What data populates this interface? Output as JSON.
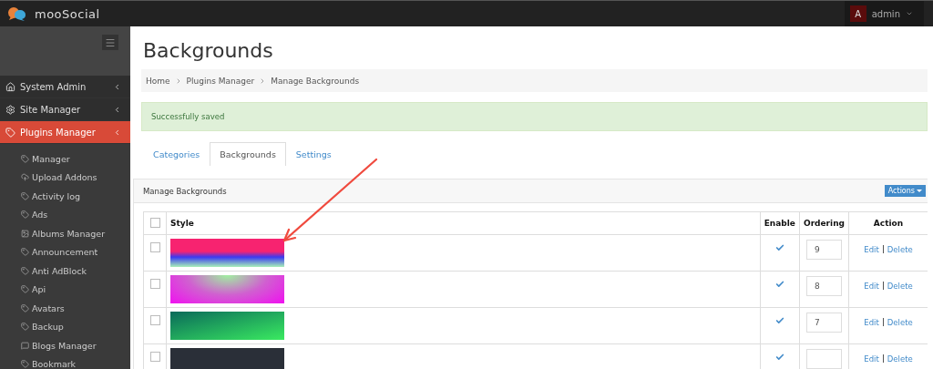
{
  "topbar": {
    "logo": "mooSocial",
    "user": {
      "initial": "A",
      "name": "admin"
    }
  },
  "sidebar": {
    "sections": [
      {
        "label": "System Admin",
        "selected": false
      },
      {
        "label": "Site Manager",
        "selected": false
      },
      {
        "label": "Plugins Manager",
        "selected": true
      }
    ],
    "items": [
      {
        "label": "Manager"
      },
      {
        "label": "Upload Addons"
      },
      {
        "label": "Activity log"
      },
      {
        "label": "Ads"
      },
      {
        "label": "Albums Manager"
      },
      {
        "label": "Announcement"
      },
      {
        "label": "Anti AdBlock"
      },
      {
        "label": "Api"
      },
      {
        "label": "Avatars"
      },
      {
        "label": "Backup"
      },
      {
        "label": "Blogs Manager"
      },
      {
        "label": "Bookmark"
      }
    ]
  },
  "page": {
    "title": "Backgrounds",
    "breadcrumb": [
      "Home",
      "Plugins Manager",
      "Manage Backgrounds"
    ],
    "alert": "Successfully saved",
    "tabs": [
      {
        "label": "Categories",
        "selected": false
      },
      {
        "label": "Backgrounds",
        "selected": true
      },
      {
        "label": "Settings",
        "selected": false
      }
    ],
    "panel": {
      "title": "Manage Backgrounds",
      "actions": "Actions",
      "table": {
        "select_all": {
          "checked": false
        },
        "columns": [
          "Style",
          "Enable",
          "Ordering",
          "Action"
        ],
        "rows": [
          {
            "checked": false,
            "kind": "vertical",
            "enabled": true,
            "ordering": "9",
            "edit": "Edit",
            "delete": "Delete"
          },
          {
            "checked": false,
            "kind": "radial",
            "enabled": true,
            "ordering": "8",
            "edit": "Edit",
            "delete": "Delete"
          },
          {
            "checked": false,
            "kind": "diagonal",
            "enabled": true,
            "ordering": "7",
            "edit": "Edit",
            "delete": "Delete"
          },
          {
            "checked": false,
            "kind": "solid",
            "enabled": true,
            "edit": "Edit",
            "delete": "Delete"
          }
        ]
      }
    }
  }
}
